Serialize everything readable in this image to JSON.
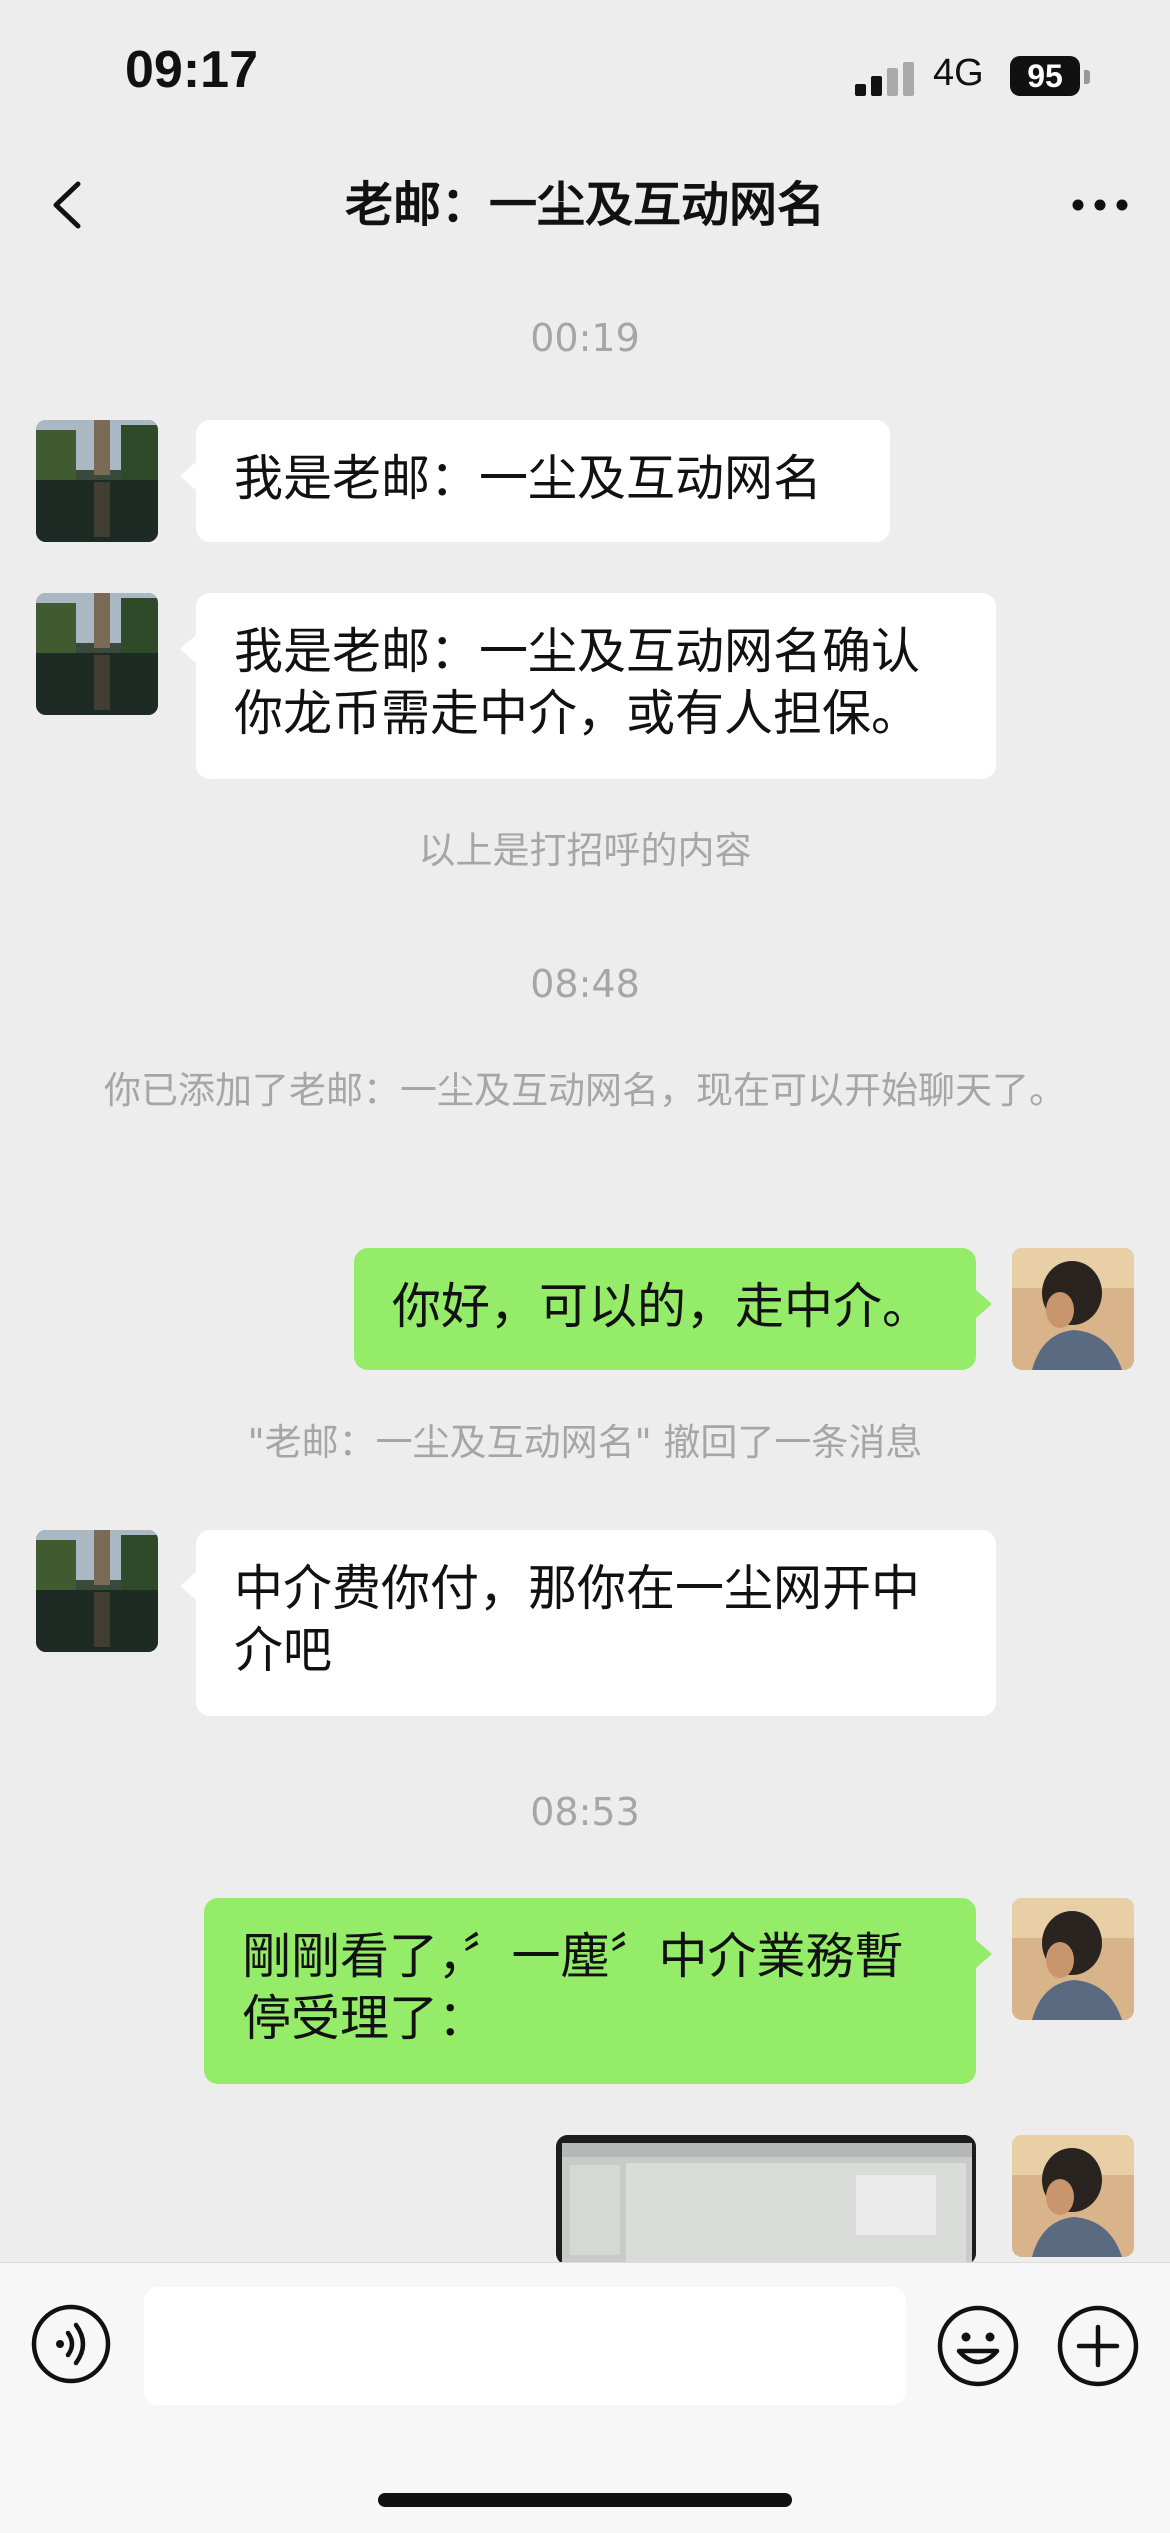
{
  "status_bar": {
    "time": "09:17",
    "network": "4G",
    "battery": "95"
  },
  "nav": {
    "title": "老邮：一尘及互动网名",
    "back_icon": "chevron-left-icon",
    "more_icon": "more-icon"
  },
  "timestamps": [
    "00:19",
    "08:48",
    "08:53"
  ],
  "messages": [
    {
      "side": "left",
      "text": "我是老邮：一尘及互动网名"
    },
    {
      "side": "left",
      "text": "我是老邮：一尘及互动网名确认\n你龙币需走中介，或有人担保。"
    },
    {
      "side": "right",
      "text": "你好，可以的，走中介。"
    },
    {
      "side": "left",
      "text": "中介费你付，那你在一尘网开中\n介吧"
    },
    {
      "side": "right",
      "text": "剛剛看了，〞一塵〞中介業務暫\n停受理了："
    }
  ],
  "system_notices": {
    "greeting": "以上是打招呼的内容",
    "added": "你已添加了老邮：一尘及互动网名，现在可以开始聊天了。",
    "recalled": "\"老邮：一尘及互动网名\" 撤回了一条消息"
  },
  "input_bar": {
    "voice_icon": "voice-icon",
    "emoji_icon": "emoji-icon",
    "plus_icon": "plus-icon"
  },
  "colors": {
    "background": "#ededed",
    "own_bubble": "#95ec69",
    "other_bubble": "#ffffff",
    "meta_text": "#a6a6a6"
  }
}
